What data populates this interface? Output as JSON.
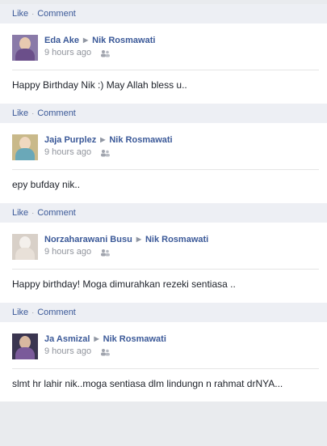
{
  "actions": {
    "like": "Like",
    "comment": "Comment",
    "sep": "·"
  },
  "target": "Nik Rosmawati",
  "posts": [
    {
      "author": "Eda Ake",
      "time": "9 hours ago",
      "message": "Happy Birthday Nik :) May Allah bless u.."
    },
    {
      "author": "Jaja Purplez",
      "time": "9 hours ago",
      "message": "epy bufday nik.."
    },
    {
      "author": "Norzaharawani Busu",
      "time": "9 hours ago",
      "message": "Happy birthday! Moga dimurahkan rezeki sentiasa .."
    },
    {
      "author": "Ja Asmizal",
      "time": "9 hours ago",
      "message": "slmt hr lahir nik..moga sentiasa dlm lindungn n rahmat drNYA..."
    }
  ],
  "colors": {
    "link": "#3b5998",
    "action_bar": "#edeff4",
    "muted": "#90949c"
  }
}
